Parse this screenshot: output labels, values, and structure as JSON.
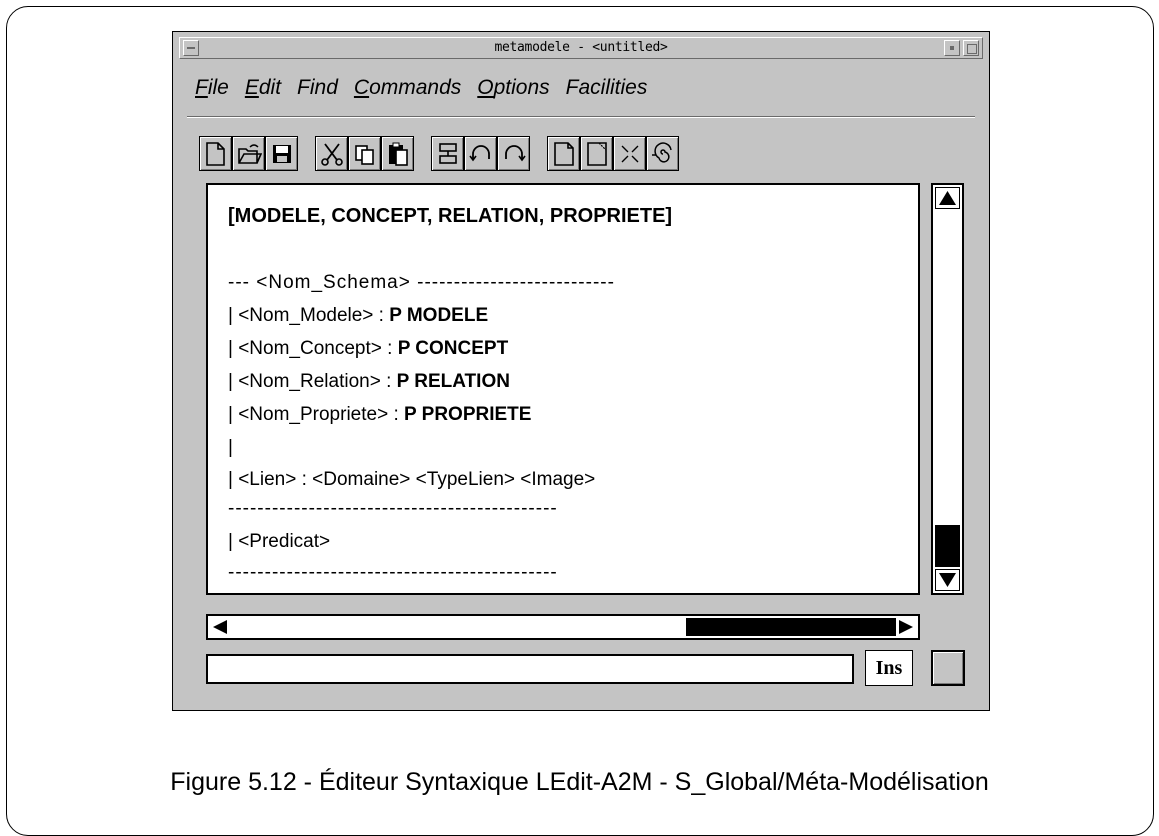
{
  "window": {
    "title": "metamodele - <untitled>"
  },
  "menu": {
    "file": {
      "ul": "F",
      "rest": "ile"
    },
    "edit": {
      "ul": "E",
      "rest": "dit"
    },
    "find": {
      "ul": "",
      "rest": "Find"
    },
    "commands": {
      "ul": "C",
      "rest": "ommands"
    },
    "options": {
      "ul": "O",
      "rest": "ptions"
    },
    "facilities": {
      "ul": "",
      "rest": "Facilities"
    }
  },
  "toolbar": {
    "icons": [
      "new-file-icon",
      "open-folder-icon",
      "save-icon",
      "cut-icon",
      "copy-icon",
      "paste-icon",
      "format-icon",
      "undo-icon",
      "redo-icon",
      "page-icon",
      "page-corner-icon",
      "expand-icon",
      "spiral-icon"
    ]
  },
  "editor": {
    "line1": "[MODELE, CONCEPT, RELATION, PROPRIETE]",
    "line2": "--- <Nom_Schema> ---------------------------",
    "line3a": "| <Nom_Modele> : ",
    "line3b": "P MODELE",
    "line4a": "| <Nom_Concept> : ",
    "line4b": "P CONCEPT",
    "line5a": "| <Nom_Relation> : ",
    "line5b": "P RELATION",
    "line6a": "| <Nom_Propriete> : ",
    "line6b": "P PROPRIETE",
    "line7": "|",
    "line8": "| <Lien> : <Domaine> <TypeLien> <Image>",
    "line9": "---------------------------------------------",
    "line10": "| <Predicat>",
    "line11": "---------------------------------------------"
  },
  "status": {
    "input_value": "",
    "mode": "Ins"
  },
  "caption": "Figure 5.12 - Éditeur Syntaxique LEdit-A2M - S_Global/Méta-Modélisation"
}
